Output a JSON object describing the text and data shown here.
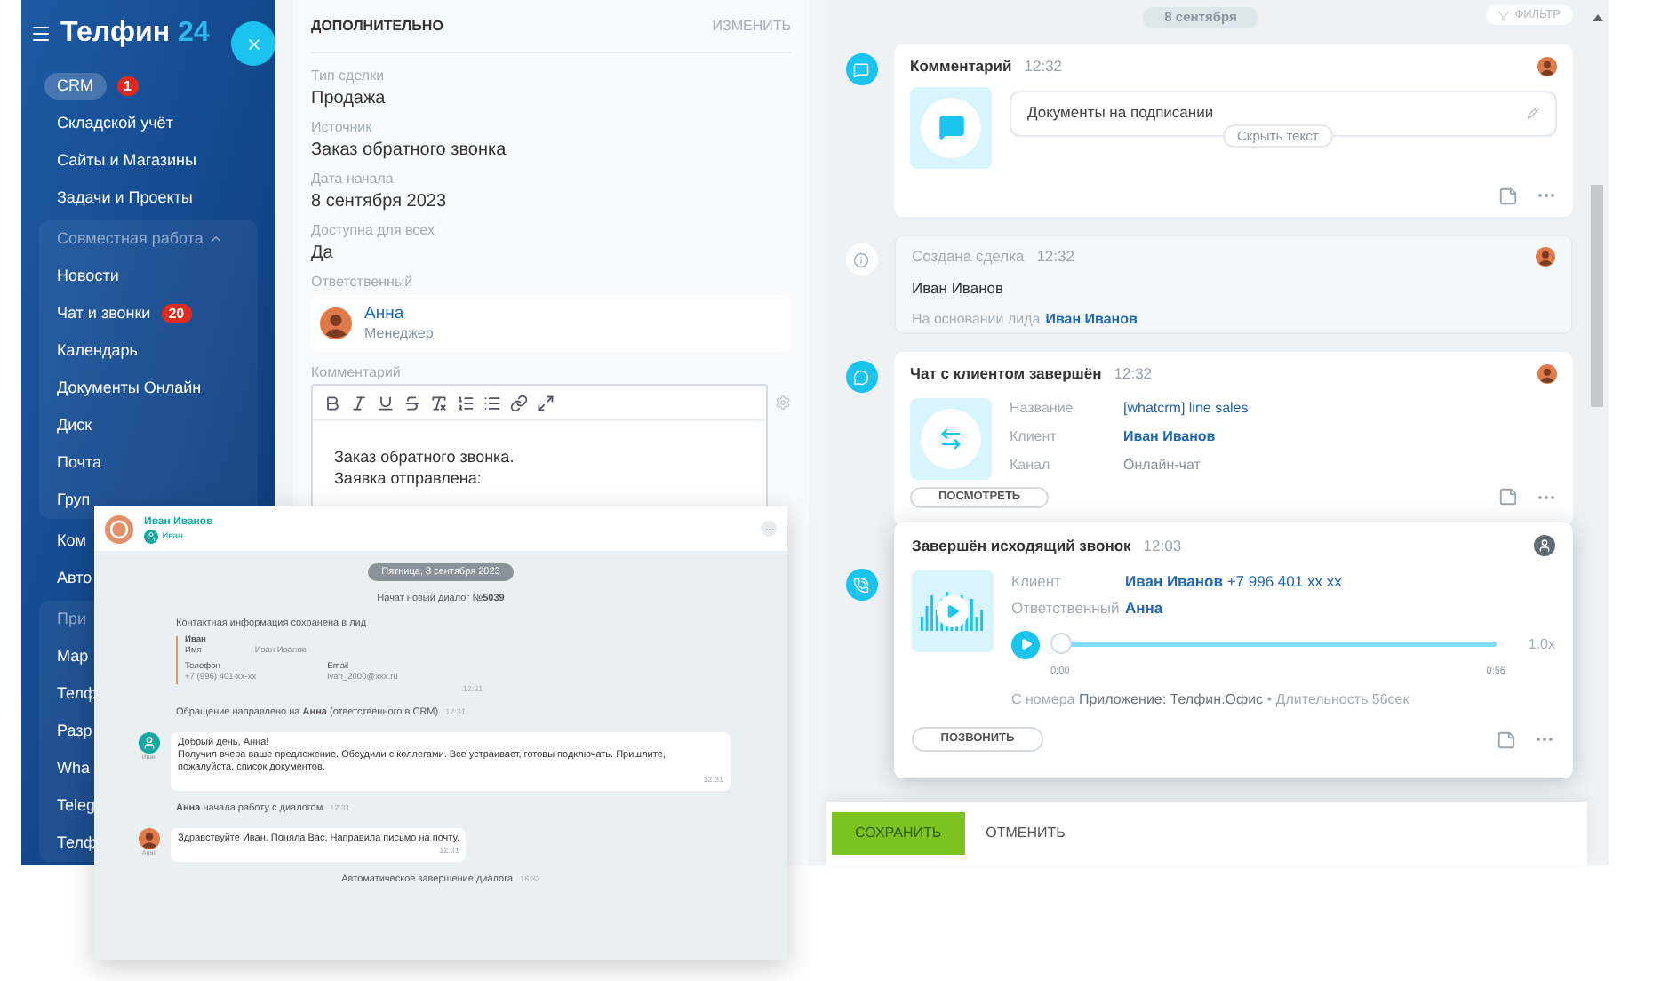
{
  "sidebar": {
    "logo": "Телфин",
    "logo_number": "24",
    "items": [
      {
        "kind": "item",
        "label": "CRM",
        "badge": "1",
        "selected": true
      },
      {
        "kind": "item",
        "label": "Складской учёт",
        "selected": false
      },
      {
        "kind": "item",
        "label": "Сайты и Магазины",
        "selected": false
      },
      {
        "kind": "item",
        "label": "Задачи и Проекты",
        "selected": false
      },
      {
        "kind": "group",
        "label": "Совместная работа",
        "expanded": true,
        "children": [
          {
            "label": "Новости",
            "selected": false
          },
          {
            "label": "Чат и звонки",
            "badge": "20",
            "selected": false
          },
          {
            "label": "Календарь",
            "selected": false
          },
          {
            "label": "Документы Онлайн",
            "selected": false
          },
          {
            "label": "Диск",
            "selected": false
          },
          {
            "label": "Почта",
            "selected": false
          },
          {
            "label": "Груп",
            "selected": false
          }
        ]
      },
      {
        "kind": "item",
        "label": "Ком",
        "selected": false
      },
      {
        "kind": "item",
        "label": "Авто",
        "selected": false
      },
      {
        "kind": "group",
        "label": "При",
        "children": [
          {
            "label": "Мар",
            "selected": false
          },
          {
            "label": "Телф",
            "selected": false
          },
          {
            "label": "Разр",
            "selected": false
          },
          {
            "label": "Wha",
            "selected": false
          },
          {
            "label": "Teleg",
            "selected": false
          },
          {
            "label": "Телф",
            "selected": false
          }
        ]
      }
    ]
  },
  "details": {
    "title": "ДОПОЛНИТЕЛЬНО",
    "edit": "ИЗМЕНИТЬ",
    "fields": [
      {
        "label": "Тип сделки",
        "value": "Продажа"
      },
      {
        "label": "Источник",
        "value": "Заказ обратного звонка"
      },
      {
        "label": "Дата начала",
        "value": "8 сентября 2023"
      },
      {
        "label": "Доступна для всех",
        "value": "Да"
      }
    ],
    "responsible": {
      "label": "Ответственный",
      "name": "Анна",
      "role": "Менеджер"
    },
    "comment": {
      "label": "Комментарий",
      "lines": [
        "Заказ обратного звонка.",
        "Заявка отправлена:"
      ]
    }
  },
  "timeline": {
    "date": "8 сентября",
    "filter": "ФИЛЬТР",
    "events": [
      {
        "kind": "comment",
        "title": "Комментарий",
        "time": "12:32",
        "text": "Документы на подписании",
        "toggle": "Скрыть текст"
      },
      {
        "kind": "info",
        "title": "Создана сделка",
        "time": "12:32",
        "name": "Иван Иванов",
        "basis": "На основании лида",
        "basis_link": "Иван Иванов"
      },
      {
        "kind": "chat",
        "title": "Чат с клиентом завершён",
        "time": "12:32",
        "fields": [
          {
            "label": "Название",
            "value": "[whatcrm] line sales",
            "kind": "link"
          },
          {
            "label": "Клиент",
            "value": "Иван Иванов",
            "kind": "strong_link"
          },
          {
            "label": "Канал",
            "value": "Онлайн-чат",
            "kind": "plain"
          }
        ],
        "button": "ПОСМОТРЕТЬ"
      },
      {
        "kind": "call",
        "title": "Завершён исходящий звонок",
        "time": "12:03",
        "fields": [
          {
            "label": "Клиент",
            "value": "**Иван Иванов** +7 996 401 xx xx",
            "kind": "link"
          },
          {
            "label": "Ответственный",
            "value": "Анна",
            "kind": "strong_link"
          }
        ],
        "level": 0,
        "speed": "1.0x",
        "start": "0:00",
        "end": "0:56",
        "note": "С номера **Приложение: Телфин.Офис** • Длительность 56сек",
        "button": "ПОЗВОНИТЬ"
      }
    ]
  },
  "footer": {
    "save": "СОХРАНИТЬ",
    "cancel": "ОТМЕНИТЬ"
  },
  "chat_window": {
    "name": "Иван Иванов",
    "contact": "Иван",
    "messages": [
      {
        "kind": "date",
        "text": "Пятница, 8 сентября 2023"
      },
      {
        "kind": "system",
        "text": "Начат новый диалог №**5039**"
      },
      {
        "kind": "contact",
        "title": "Контактная информация сохранена в лид",
        "name": "Иван",
        "name_field": {
          "label": "Имя",
          "value": "Иван Иванов"
        },
        "columns": [
          {
            "label": "Телефон",
            "value": "+7 (996) 401-xx-xx"
          },
          {
            "label": "Email",
            "value": "ivan_2000@xxx.ru"
          }
        ],
        "time": "12:31"
      },
      {
        "kind": "system",
        "text": "Обращение направлено на **Анна** (ответственного в CRM)",
        "time": "12:31"
      },
      {
        "kind": "incoming",
        "author": "Иван",
        "lines": [
          "Добрый день, Анна!",
          "Получил вчера ваше предложение. Обсудили с коллегами. Все устраивает, готовы подключать. Пришлите, пожалуйста, список документов."
        ],
        "time": "12:31"
      },
      {
        "kind": "system",
        "text": "**Анна** начала работу с диалогом",
        "time": "12:31"
      },
      {
        "kind": "outgoing",
        "author": "Анна",
        "lines": [
          "Здравствуйте Иван. Поняла Вас. Направила письмо на почту."
        ],
        "time": "12:31"
      },
      {
        "kind": "system",
        "text": "Автоматическое завершение диалога",
        "time": "16:32"
      }
    ]
  }
}
